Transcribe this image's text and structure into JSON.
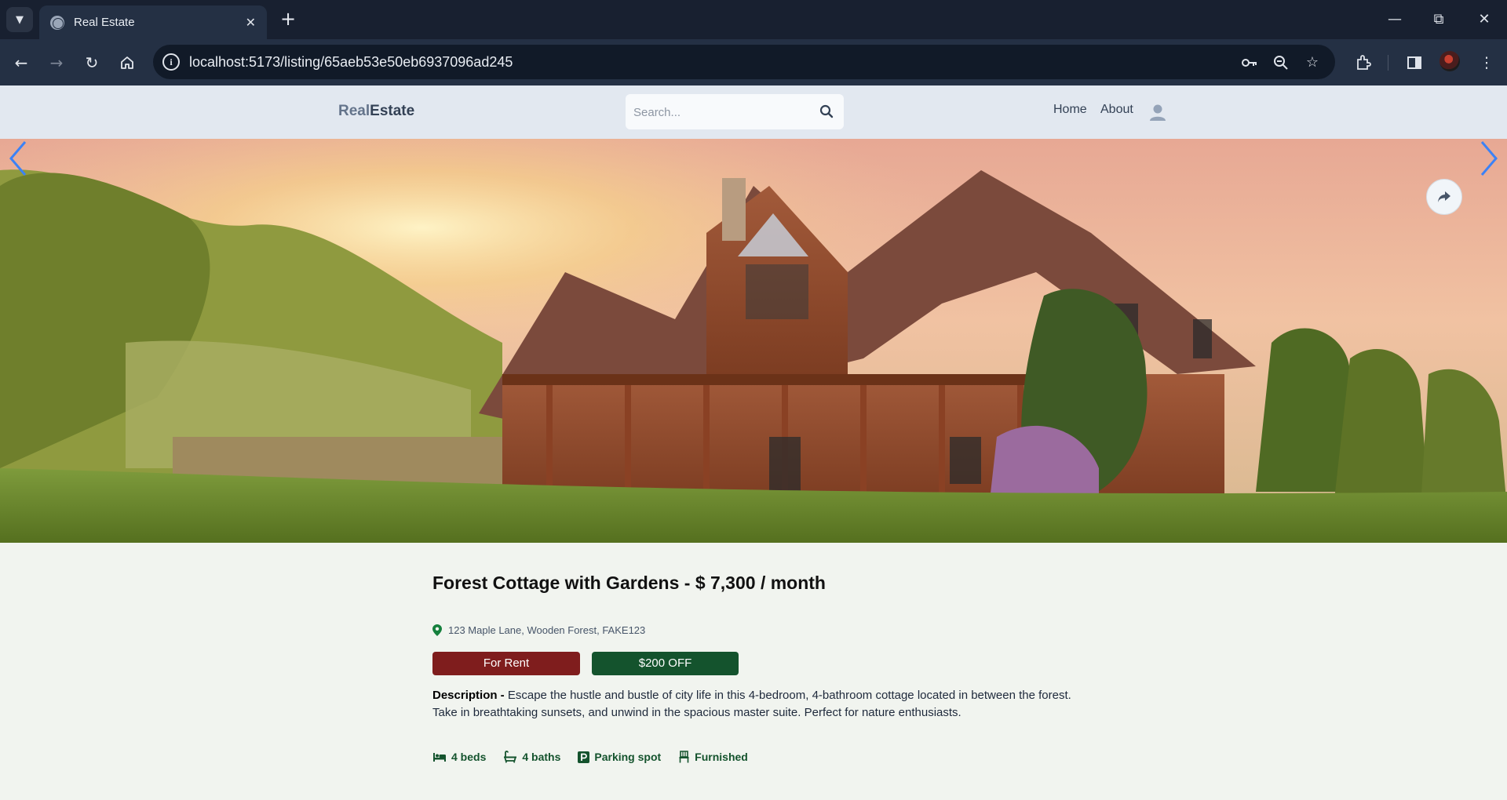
{
  "browser": {
    "tab_title": "Real Estate",
    "url": "localhost:5173/listing/65aeb53e50eb6937096ad245",
    "icons": [
      "tab-list-icon",
      "globe-icon",
      "close-icon",
      "plus-icon",
      "minimize-icon",
      "restore-icon",
      "window-close-icon",
      "back-icon",
      "forward-icon",
      "reload-icon",
      "home-icon",
      "site-info-icon",
      "key-icon",
      "zoom-icon",
      "star-icon",
      "extensions-icon",
      "sidebar-icon",
      "menu-icon"
    ]
  },
  "header": {
    "logo_part1": "Real",
    "logo_part2": "Estate",
    "search_placeholder": "Search...",
    "nav": {
      "home": "Home",
      "about": "About"
    }
  },
  "listing": {
    "title": "Forest Cottage with Gardens - $ 7,300 / month",
    "address": "123 Maple Lane, Wooden Forest, FAKE123",
    "badge_type": "For Rent",
    "badge_discount": "$200 OFF",
    "description_label": "Description - ",
    "description": "Escape the hustle and bustle of city life in this 4-bedroom, 4-bathroom cottage located in between the forest. Take in breathtaking sunsets, and unwind in the spacious master suite. Perfect for nature enthusiasts.",
    "features": {
      "beds": "4 beds",
      "baths": "4 baths",
      "parking": "Parking spot",
      "furnished": "Furnished"
    }
  },
  "colors": {
    "header_bg": "#e2e8f0",
    "page_bg": "#f1f4ef",
    "rent_badge": "#7f1d1d",
    "discount_badge": "#14532d",
    "feature_text": "#14532d"
  }
}
